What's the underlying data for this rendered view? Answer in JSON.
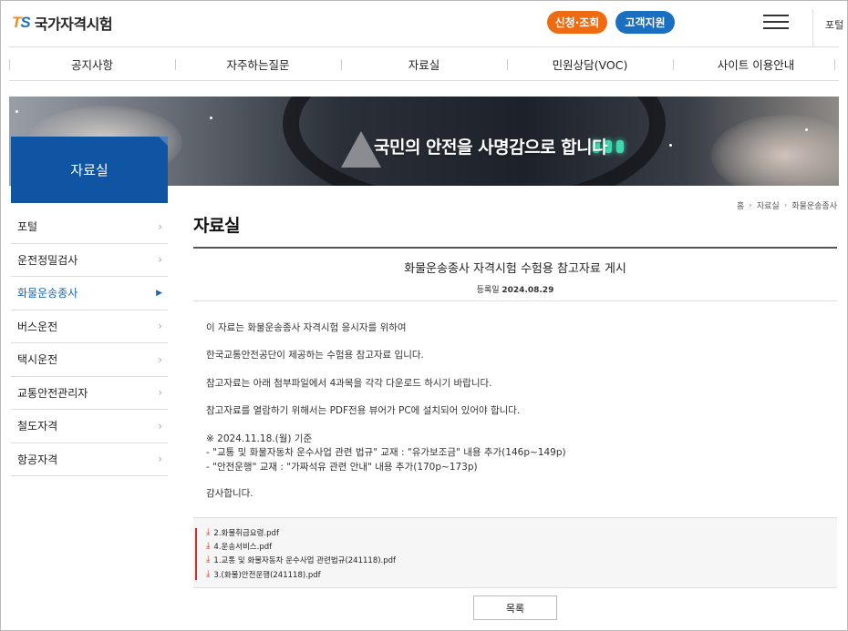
{
  "header": {
    "logo_mark_t": "T",
    "logo_mark_s": "S",
    "logo_text": "국가자격시험",
    "btn_apply": "신청·조회",
    "btn_support": "고객지원",
    "cut_text": "포털"
  },
  "gnb": [
    "공지사항",
    "자주하는질문",
    "자료실",
    "민원상담(VOC)",
    "사이트 이용안내"
  ],
  "banner": {
    "slogan": "국민의 안전을 사명감으로 합니다"
  },
  "sidebar": {
    "title": "자료실",
    "items": [
      {
        "label": "포털",
        "active": false
      },
      {
        "label": "운전정밀검사",
        "active": false
      },
      {
        "label": "화물운송종사",
        "active": true
      },
      {
        "label": "버스운전",
        "active": false
      },
      {
        "label": "택시운전",
        "active": false
      },
      {
        "label": "교통안전관리자",
        "active": false
      },
      {
        "label": "철도자격",
        "active": false
      },
      {
        "label": "항공자격",
        "active": false
      }
    ]
  },
  "breadcrumb": [
    "홈",
    "자료실",
    "화물운송종사"
  ],
  "page_title": "자료실",
  "post": {
    "title": "화물운송종사 자격시험 수험용 참고자료 게시",
    "date_label": "등록일",
    "date": "2024.08.29",
    "body": [
      "이 자료는 화물운송종사 자격시험 응시자를 위하여",
      "한국교통안전공단이 제공하는 수험용 참고자료 입니다.",
      "참고자료는 아래 첨부파일에서 4과목을 각각 다운로드 하시기 바랍니다.",
      "참고자료를 열람하기 위해서는 PDF전용 뷰어가 PC에 설치되어 있어야 합니다.",
      "※ 2024.11.18.(월) 기준",
      "- \"교통 및 화물자동차 운수사업 관련 법규\" 교재 : \"유가보조금\" 내용 추가(146p~149p)",
      "- \"안전운행\" 교재 : \"가짜석유 관련 안내\" 내용 추가(170p~173p)",
      "감사합니다."
    ],
    "files": [
      "2.화물취급요령.pdf",
      "4.운송서비스.pdf",
      "1.교통 및 화물자동차 운수사업 관련법규(241118).pdf",
      "3.(화물)안전운행(241118).pdf"
    ]
  },
  "list_button": "목록",
  "colors": {
    "brand_blue": "#0f55a3",
    "accent_orange": "#ef6b12",
    "support_blue": "#1b6fc1",
    "active_link": "#1a66b8",
    "file_bar": "#d72c2c"
  },
  "icons": [
    "hamburger-menu-icon",
    "chevron-right-icon",
    "download-icon"
  ]
}
